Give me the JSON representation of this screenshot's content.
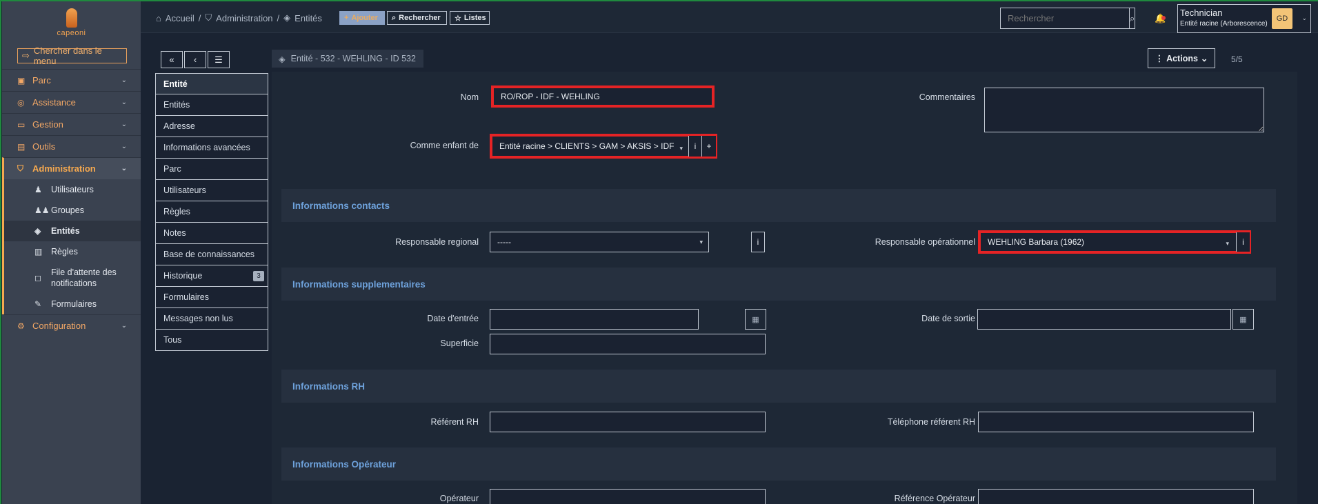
{
  "sidebar": {
    "brand": "capeoni",
    "menu_search": "Chercher dans le menu",
    "items": [
      {
        "label": "Parc",
        "icon": "box-icon"
      },
      {
        "label": "Assistance",
        "icon": "lifebuoy-icon"
      },
      {
        "label": "Gestion",
        "icon": "wallet-icon"
      },
      {
        "label": "Outils",
        "icon": "briefcase-icon"
      },
      {
        "label": "Administration",
        "icon": "shield-icon"
      },
      {
        "label": "Configuration",
        "icon": "gear-icon"
      }
    ],
    "sub_items": [
      {
        "label": "Utilisateurs",
        "icon": "user-icon"
      },
      {
        "label": "Groupes",
        "icon": "users-icon"
      },
      {
        "label": "Entités",
        "icon": "layers-icon"
      },
      {
        "label": "Règles",
        "icon": "book-icon"
      },
      {
        "label": "File d'attente des notifications",
        "icon": "notification-icon"
      },
      {
        "label": "Formulaires",
        "icon": "form-icon"
      }
    ]
  },
  "topbar": {
    "breadcrumbs": [
      "Accueil",
      "Administration",
      "Entités"
    ],
    "add_label": "Ajouter",
    "search_label": "Rechercher",
    "lists_label": "Listes",
    "search_placeholder": "Rechercher",
    "user_name": "Technician",
    "user_entity": "Entité racine (Arborescence)",
    "user_initials": "GD"
  },
  "tabs": {
    "items": [
      "Entité",
      "Entités",
      "Adresse",
      "Informations avancées",
      "Parc",
      "Utilisateurs",
      "Règles",
      "Notes",
      "Base de connaissances",
      "Historique",
      "Formulaires",
      "Messages non lus",
      "Tous"
    ],
    "history_count": "3"
  },
  "entity": {
    "title": "Entité - 532 - WEHLING - ID 532",
    "actions_label": "Actions",
    "pager": "5/5"
  },
  "form": {
    "nom_label": "Nom",
    "nom_value": "RO/ROP - IDF - WEHLING",
    "commentaires_label": "Commentaires",
    "parent_label": "Comme enfant de",
    "parent_value": "Entité racine > CLIENTS > GAM > AKSIS > IDF",
    "section_contacts": "Informations contacts",
    "resp_regional_label": "Responsable regional",
    "resp_regional_value": "-----",
    "resp_oper_label": "Responsable opérationnel",
    "resp_oper_value": "WEHLING Barbara (1962)",
    "section_supp": "Informations supplementaires",
    "date_entree_label": "Date d'entrée",
    "date_sortie_label": "Date de sortie",
    "superficie_label": "Superficie",
    "section_rh": "Informations RH",
    "referent_rh_label": "Référent RH",
    "tel_rh_label": "Téléphone référent RH",
    "section_oper": "Informations Opérateur",
    "operateur_label": "Opérateur",
    "ref_oper_label": "Référence Opérateur"
  }
}
